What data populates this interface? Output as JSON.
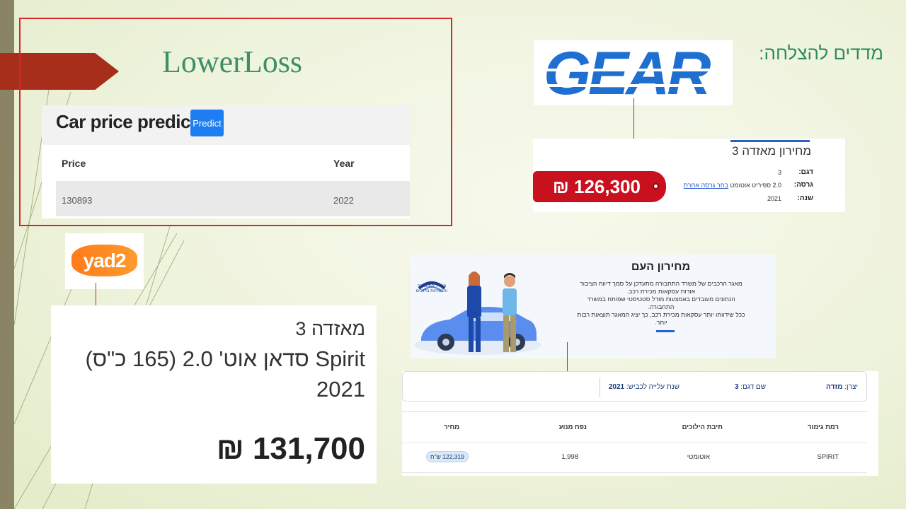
{
  "slide": {
    "title": "LowerLoss",
    "success_metrics_label": "מדדים להצלחה:"
  },
  "app": {
    "heading": "Car price prediction",
    "predict_button": "Predict",
    "columns": [
      "Price",
      "Year"
    ],
    "row": [
      "130893",
      "2022"
    ]
  },
  "gear": {
    "logo_text": "GEAR",
    "model_title": "מחירון מאזדה 3",
    "price": "126,300 ₪",
    "fields": [
      {
        "label": "דגם:",
        "value": "3"
      },
      {
        "label": "גרסה:",
        "value": "2.0 ספיריט אוטומט",
        "link": "בחר גרסה אחרת"
      },
      {
        "label": "שנה:",
        "value": "2021"
      }
    ]
  },
  "yad2": {
    "logo_text": "yad2",
    "line1": "מאזדה 3",
    "line2": "Spirit סדאן אוט' 2.0 (165 כ\"ס)",
    "line3": "2021",
    "price": "131,700 ₪"
  },
  "gov": {
    "title": "מחירון העם",
    "text": [
      "מאגר הרכבים של משרד התחבורה מתעדכן על סמך דיווח הציבור",
      "אודות עסקאות מכירת רכב.",
      "הנתונים מעובדים באמצעות מודל סטטיסטי שפותח במשרד התחבורה.",
      "ככל שידווחו יותר עסקאות מכירת רכב, כך יציג המאגר תוצאות רבות",
      "יותר."
    ],
    "emblem_text": "משרד התחבורה והבטיחות בדרכים",
    "filters": {
      "maker_label": "יצרן:",
      "maker": "מזדה",
      "model_label": "שם דגם:",
      "model": "3",
      "year_label": "שנת עלייה לכביש:",
      "year": "2021"
    },
    "table_headers": [
      "רמת גימור",
      "תיבת הילוכים",
      "נפח מנוע",
      "מחיר"
    ],
    "table_row": [
      "SPIRIT",
      "אוטומטי",
      "1,998",
      "122,319 ש\"ח"
    ]
  }
}
